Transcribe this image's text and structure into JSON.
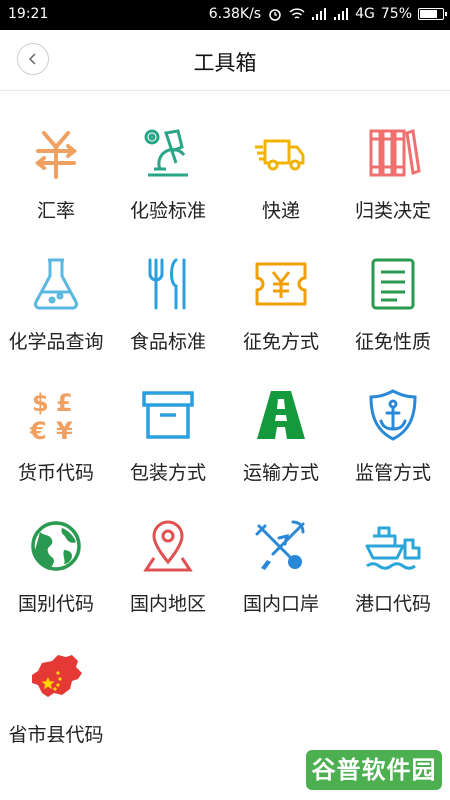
{
  "status_bar": {
    "time": "19:21",
    "speed": "6.38K/s",
    "network": "4G",
    "battery": "75%",
    "battery_level": 0.75
  },
  "header": {
    "title": "工具箱",
    "back_icon": "chevron-left-icon"
  },
  "tools": [
    {
      "label": "汇率",
      "icon": "yuan-exchange-icon",
      "color": "#f0a060"
    },
    {
      "label": "化验标准",
      "icon": "microscope-icon",
      "color": "#2aa587"
    },
    {
      "label": "快递",
      "icon": "delivery-truck-icon",
      "color": "#f0b400"
    },
    {
      "label": "归类决定",
      "icon": "books-icon",
      "color": "#f07070"
    },
    {
      "label": "化学品查询",
      "icon": "flask-icon",
      "color": "#5ab8e0"
    },
    {
      "label": "食品标准",
      "icon": "fork-knife-icon",
      "color": "#2a9fe0"
    },
    {
      "label": "征免方式",
      "icon": "yuan-ticket-icon",
      "color": "#f0a000"
    },
    {
      "label": "征免性质",
      "icon": "document-list-icon",
      "color": "#2a9a50"
    },
    {
      "label": "货币代码",
      "icon": "currency-symbols-icon",
      "color": "#f0a060"
    },
    {
      "label": "包装方式",
      "icon": "storage-box-icon",
      "color": "#2a9fe0"
    },
    {
      "label": "运输方式",
      "icon": "road-icon",
      "color": "#149a3c"
    },
    {
      "label": "监管方式",
      "icon": "anchor-shield-icon",
      "color": "#2a88d8"
    },
    {
      "label": "国别代码",
      "icon": "globe-icon",
      "color": "#2a9a50"
    },
    {
      "label": "国内地区",
      "icon": "map-pin-icon",
      "color": "#e05050"
    },
    {
      "label": "国内口岸",
      "icon": "customs-emblem-icon",
      "color": "#2a88d8"
    },
    {
      "label": "港口代码",
      "icon": "ship-icon",
      "color": "#2aa6d8"
    },
    {
      "label": "省市县代码",
      "icon": "china-map-icon",
      "color": "#e53935"
    }
  ],
  "watermark": "谷普软件园"
}
